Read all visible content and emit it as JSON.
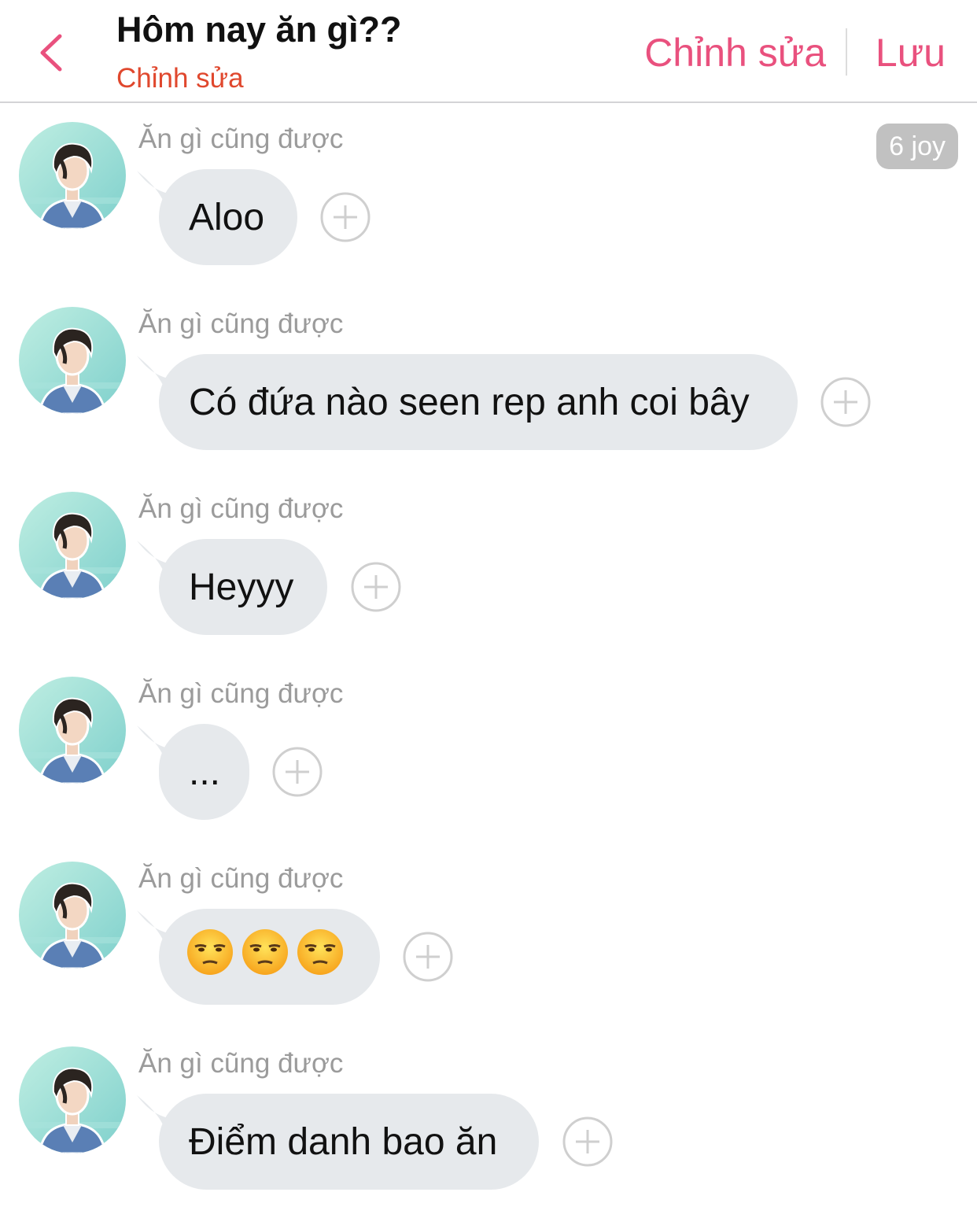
{
  "header": {
    "title": "Hôm nay ăn gì??",
    "subtitle": "Chỉnh sửa",
    "edit_label": "Chỉnh sửa",
    "save_label": "Lưu"
  },
  "colors": {
    "accent": "#e9517e",
    "subtitle": "#e0482e",
    "bubble": "#e6e9ec",
    "sender": "#9b9b9b",
    "badge": "#c1c1c1"
  },
  "badge": "6 joy",
  "messages": [
    {
      "sender": "Ăn gì cũng được",
      "text": "Aloo"
    },
    {
      "sender": "Ăn gì cũng được",
      "text": "Có đứa nào seen rep anh coi bây"
    },
    {
      "sender": "Ăn gì cũng được",
      "text": "Heyyy"
    },
    {
      "sender": "Ăn gì cũng được",
      "text": "..."
    },
    {
      "sender": "Ăn gì cũng được",
      "text": "",
      "emoji": [
        "😒",
        "😒",
        "😒"
      ]
    },
    {
      "sender": "Ăn gì cũng được",
      "text": "Điểm danh bao ăn"
    }
  ],
  "icons": {
    "back": "chevron-left-icon",
    "add": "plus-circle-icon",
    "avatar": "user-avatar"
  }
}
